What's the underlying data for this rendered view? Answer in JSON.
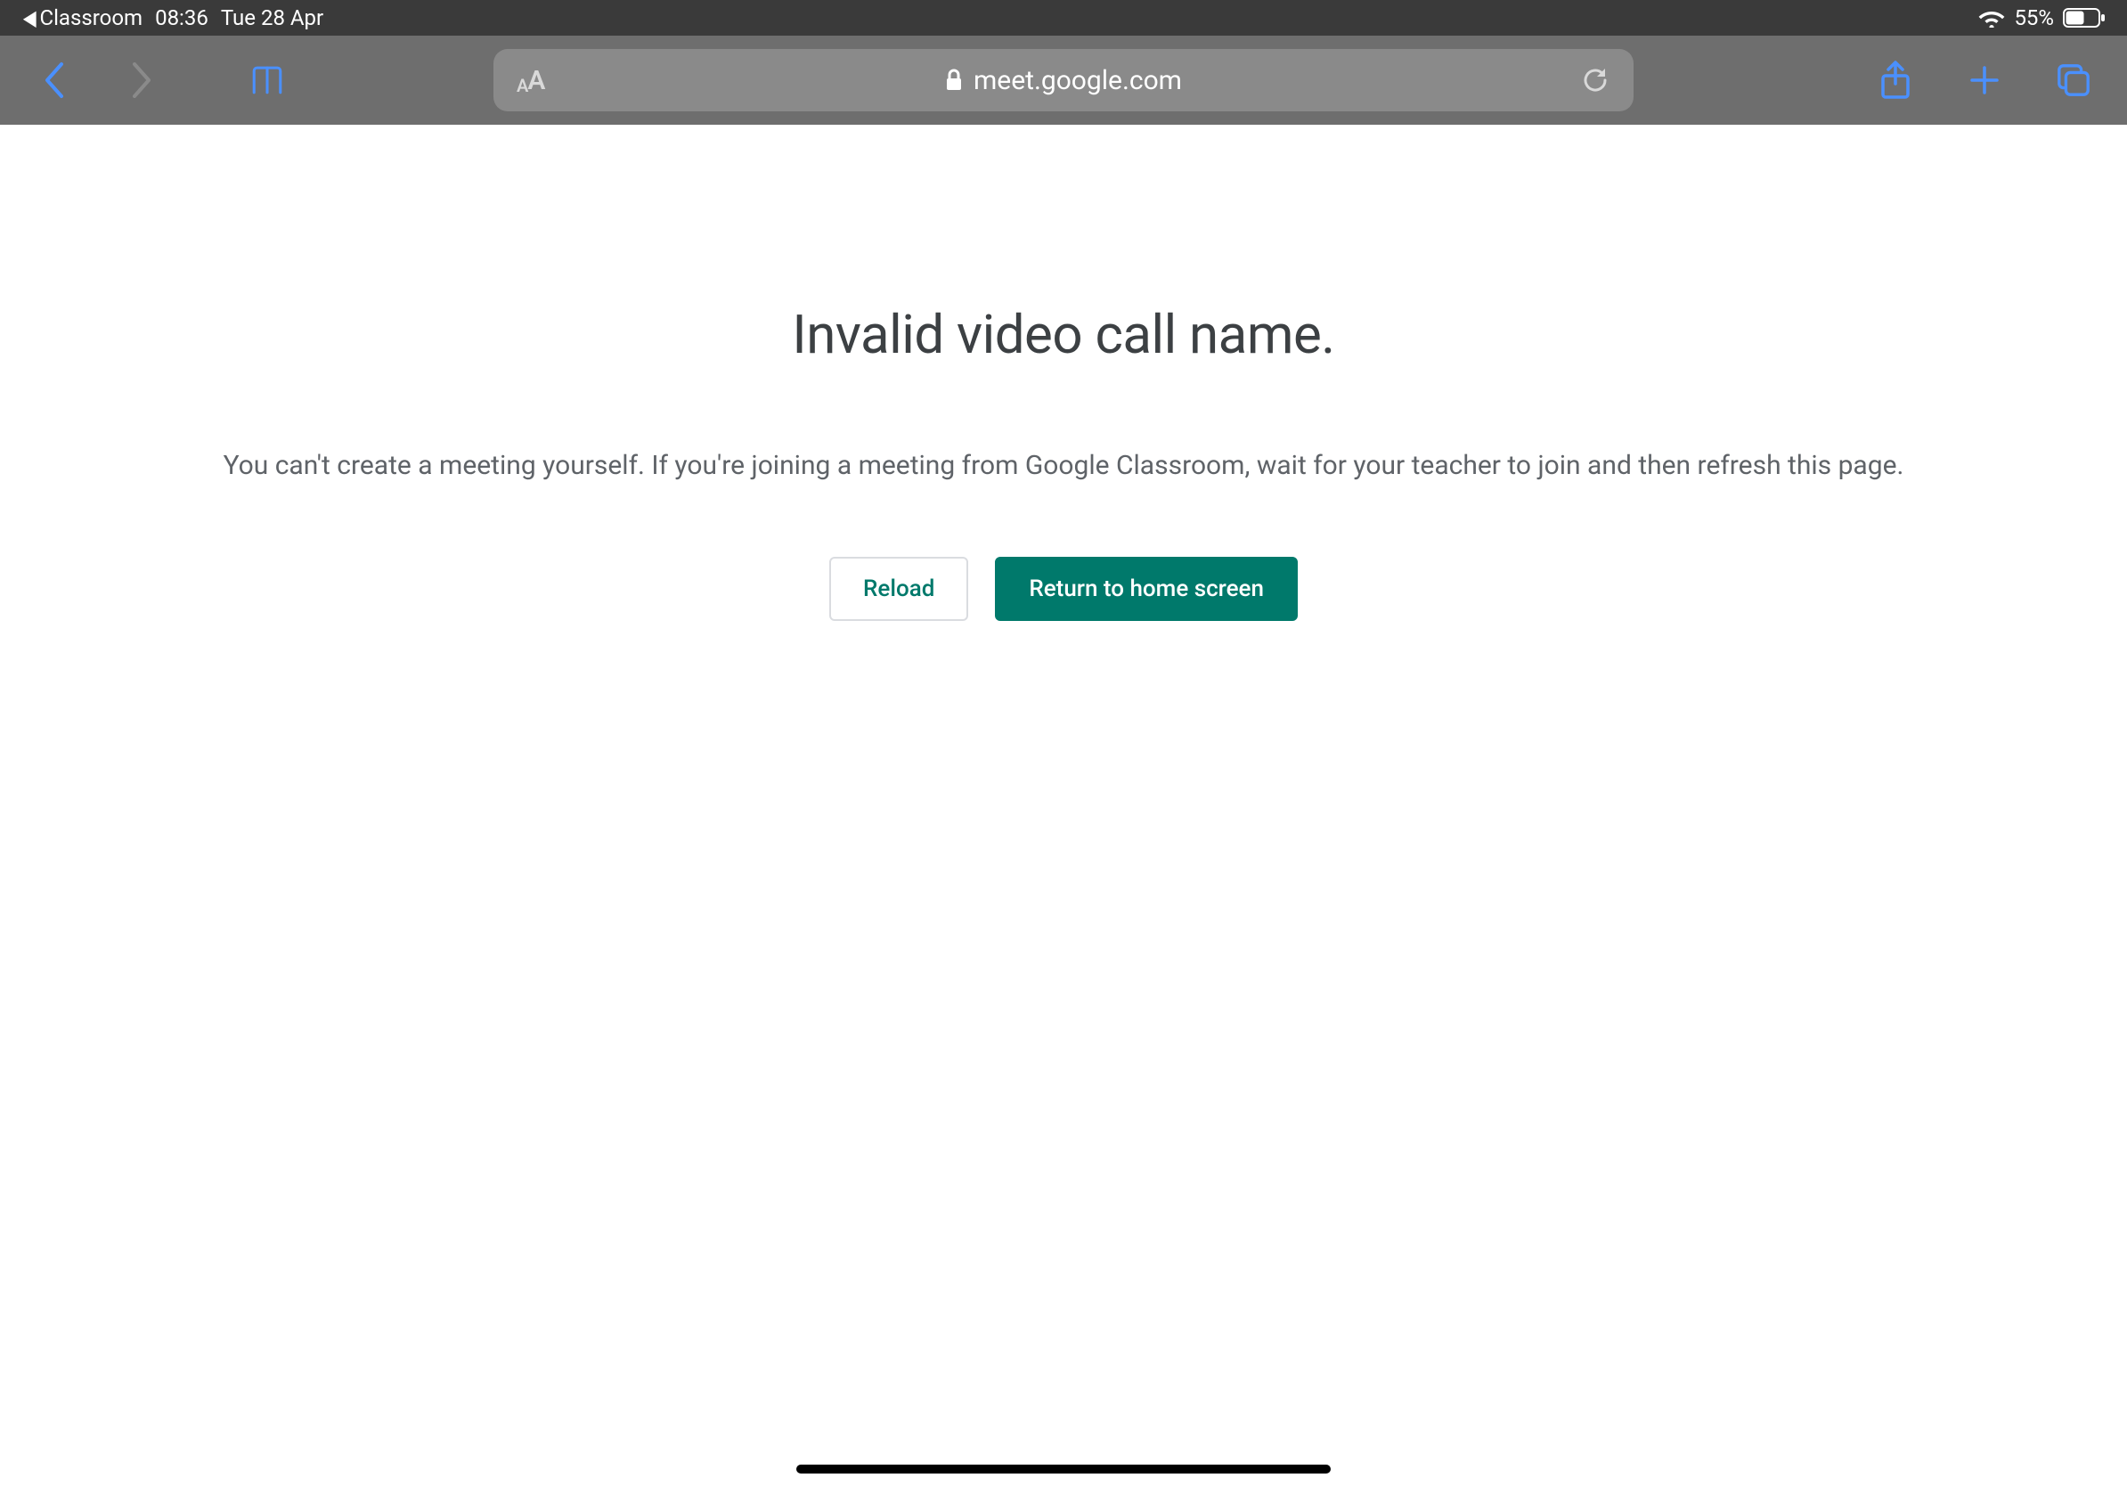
{
  "status": {
    "back_app_label": "Classroom",
    "time": "08:36",
    "date": "Tue 28 Apr",
    "battery_pct": "55%"
  },
  "safari": {
    "url": "meet.google.com"
  },
  "page": {
    "title": "Invalid video call name.",
    "subtitle": "You can't create a meeting yourself. If you're joining a meeting from Google Classroom, wait for your teacher to join and then refresh this page.",
    "reload_label": "Reload",
    "home_label": "Return to home screen"
  }
}
